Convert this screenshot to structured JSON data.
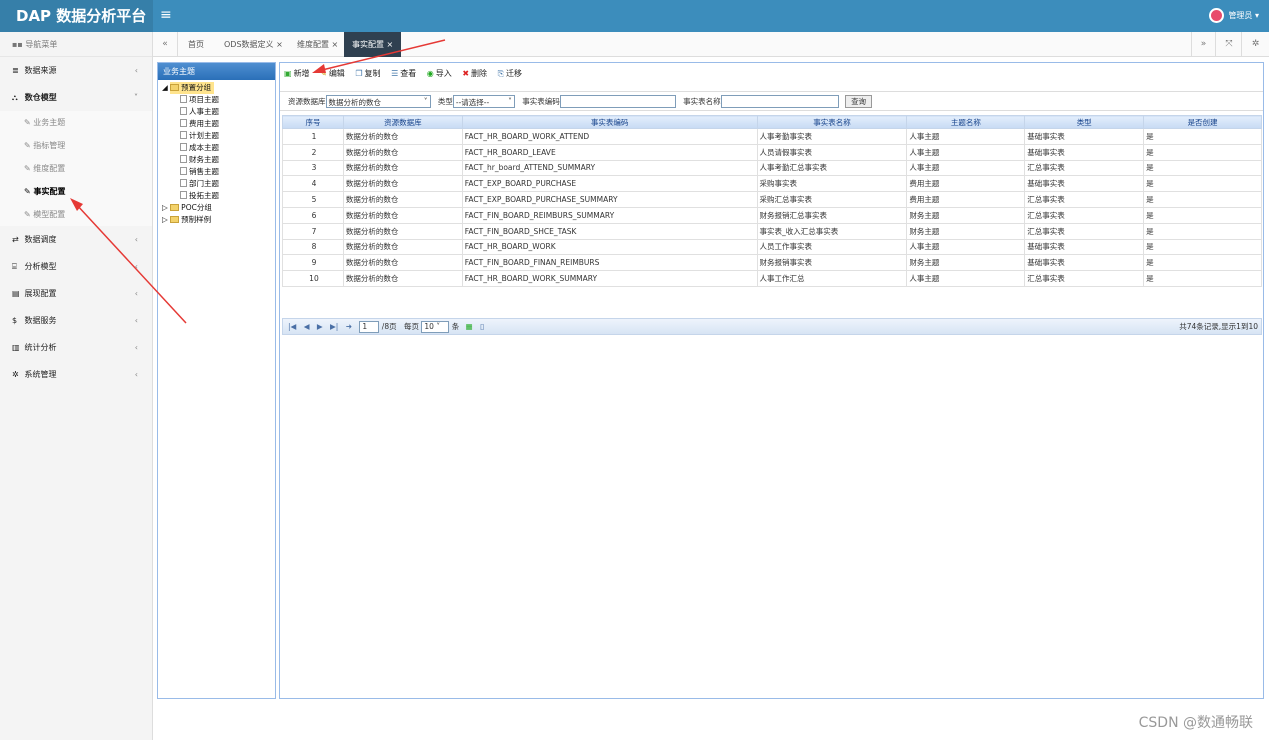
{
  "header": {
    "brand": "DAP 数据分析平台",
    "menu_icon": "≡",
    "user_label": "管理员 ▾"
  },
  "sidebar": {
    "title": "导航菜单",
    "items": [
      {
        "icon": "≣",
        "label": "数据来源",
        "chev": "‹"
      },
      {
        "icon": "⛬",
        "label": "数仓模型",
        "chev": "˅"
      },
      {
        "icon": "⇄",
        "label": "数据调度",
        "chev": "‹"
      },
      {
        "icon": "⌸",
        "label": "分析模型",
        "chev": "‹"
      },
      {
        "icon": "▤",
        "label": "展现配置",
        "chev": "‹"
      },
      {
        "icon": "$",
        "label": "数据服务",
        "chev": "‹"
      },
      {
        "icon": "▥",
        "label": "统计分析",
        "chev": "‹"
      },
      {
        "icon": "✲",
        "label": "系统管理",
        "chev": "‹"
      }
    ],
    "subitems": [
      "业务主题",
      "指标管理",
      "维度配置",
      "事实配置",
      "模型配置"
    ]
  },
  "tabs": [
    "首页",
    "ODS数据定义 ×",
    "维度配置 ×",
    "事实配置 ×"
  ],
  "tree": {
    "title": "业务主题",
    "root": "预置分组",
    "children": [
      "项目主题",
      "人事主题",
      "费用主题",
      "计划主题",
      "成本主题",
      "财务主题",
      "销售主题",
      "部门主题",
      "投拓主题"
    ],
    "others": [
      "POC分组",
      "预制样例"
    ]
  },
  "toolbar": [
    "新增",
    "编辑",
    "复制",
    "查看",
    "导入",
    "删除",
    "迁移"
  ],
  "filter": {
    "db_label": "资源数据库",
    "db_value": "数据分析的数仓",
    "type_label": "类型",
    "type_value": "--请选择--",
    "code_label": "事实表编码",
    "name_label": "事实表名称",
    "query": "查询"
  },
  "table": {
    "columns": [
      "序号",
      "资源数据库",
      "事实表编码",
      "事实表名称",
      "主题名称",
      "类型",
      "是否创建"
    ],
    "rows": [
      [
        "1",
        "数据分析的数仓",
        "FACT_HR_BOARD_WORK_ATTEND",
        "人事考勤事实表",
        "人事主题",
        "基础事实表",
        "是"
      ],
      [
        "2",
        "数据分析的数仓",
        "FACT_HR_BOARD_LEAVE",
        "人员请假事实表",
        "人事主题",
        "基础事实表",
        "是"
      ],
      [
        "3",
        "数据分析的数仓",
        "FACT_hr_board_ATTEND_SUMMARY",
        "人事考勤汇总事实表",
        "人事主题",
        "汇总事实表",
        "是"
      ],
      [
        "4",
        "数据分析的数仓",
        "FACT_EXP_BOARD_PURCHASE",
        "采购事实表",
        "费用主题",
        "基础事实表",
        "是"
      ],
      [
        "5",
        "数据分析的数仓",
        "FACT_EXP_BOARD_PURCHASE_SUMMARY",
        "采购汇总事实表",
        "费用主题",
        "汇总事实表",
        "是"
      ],
      [
        "6",
        "数据分析的数仓",
        "FACT_FIN_BOARD_REIMBURS_SUMMARY",
        "财务报销汇总事实表",
        "财务主题",
        "汇总事实表",
        "是"
      ],
      [
        "7",
        "数据分析的数仓",
        "FACT_FIN_BOARD_SHCE_TASK",
        "事实表_收入汇总事实表",
        "财务主题",
        "汇总事实表",
        "是"
      ],
      [
        "8",
        "数据分析的数仓",
        "FACT_HR_BOARD_WORK",
        "人员工作事实表",
        "人事主题",
        "基础事实表",
        "是"
      ],
      [
        "9",
        "数据分析的数仓",
        "FACT_FIN_BOARD_FINAN_REIMBURS",
        "财务报销事实表",
        "财务主题",
        "基础事实表",
        "是"
      ],
      [
        "10",
        "数据分析的数仓",
        "FACT_HR_BOARD_WORK_SUMMARY",
        "人事工作汇总",
        "人事主题",
        "汇总事实表",
        "是"
      ]
    ]
  },
  "pager": {
    "page": "1",
    "total_pages": "/8页",
    "per_page_label": "每页",
    "per_page": "10",
    "unit": "条",
    "info": "共74条记录,显示1到10"
  },
  "watermark": "CSDN @数通畅联"
}
